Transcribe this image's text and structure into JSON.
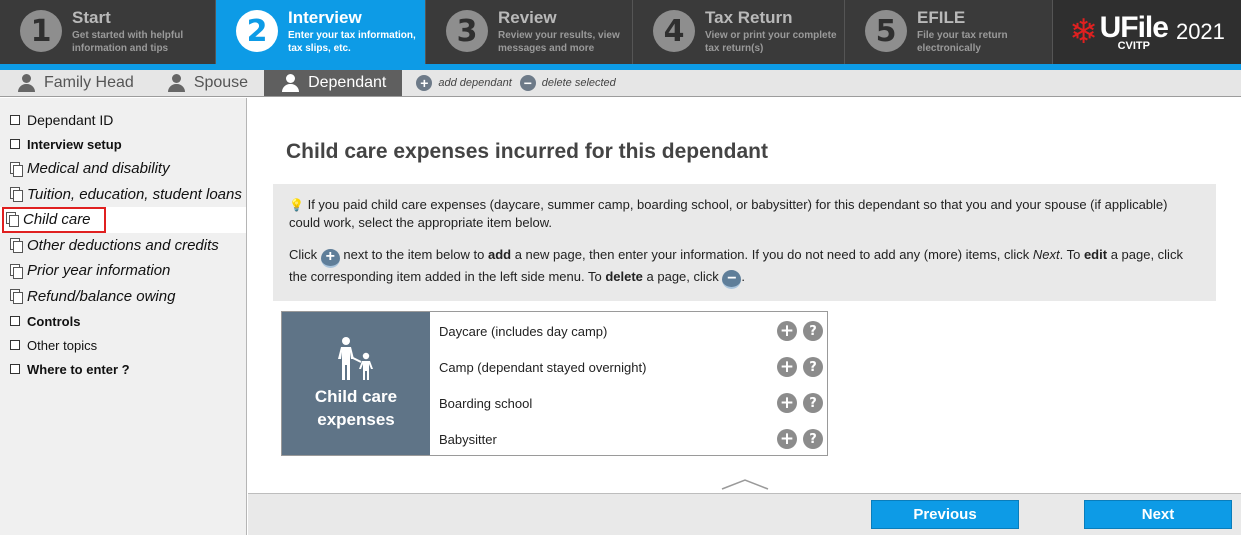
{
  "steps": [
    {
      "num": "1",
      "title": "Start",
      "desc1": "Get started with helpful",
      "desc2": "information and tips"
    },
    {
      "num": "2",
      "title": "Interview",
      "desc1": "Enter your tax information,",
      "desc2": "tax slips, etc."
    },
    {
      "num": "3",
      "title": "Review",
      "desc1": "Review your results, view",
      "desc2": "messages and more"
    },
    {
      "num": "4",
      "title": "Tax Return",
      "desc1": "View or print your complete",
      "desc2": "tax return(s)"
    },
    {
      "num": "5",
      "title": "EFILE",
      "desc1": "File your tax return",
      "desc2": "electronically"
    }
  ],
  "brand": {
    "name": "UFile",
    "sub": "CVITP",
    "year": "2021"
  },
  "tabs": [
    {
      "label": "Family Head"
    },
    {
      "label": "Spouse"
    },
    {
      "label": "Dependant"
    }
  ],
  "tab_actions": {
    "add": "add dependant",
    "delete": "delete selected"
  },
  "sidebar": {
    "items": [
      {
        "label": "Dependant ID"
      },
      {
        "label": "Interview setup"
      },
      {
        "label": "Medical and disability"
      },
      {
        "label": "Tuition, education, student loans"
      },
      {
        "label": "Child care"
      },
      {
        "label": "Other deductions and credits"
      },
      {
        "label": "Prior year information"
      },
      {
        "label": "Refund/balance owing"
      },
      {
        "label": "Controls"
      },
      {
        "label": "Other topics"
      },
      {
        "label": "Where to enter ?"
      }
    ]
  },
  "main": {
    "heading": "Child care expenses incurred for this dependant",
    "info1": "If you paid child care expenses (daycare, summer camp, boarding school, or babysitter) for this dependant so that you and your spouse (if applicable) could work, select the appropriate item below.",
    "info2_a": "Click",
    "info2_b": "next to the item below to",
    "info2_add": "add",
    "info2_c": "a new page, then enter your information. If you do not need to add any (more) items, click",
    "info2_next": "Next",
    "info2_d": ". To",
    "info2_edit": "edit",
    "info2_e": "a page, click the corresponding item added in the left side menu. To",
    "info2_delete": "delete",
    "info2_f": "a page, click",
    "info2_g": ".",
    "card_title_1": "Child care",
    "card_title_2": "expenses",
    "rows": [
      {
        "label": "Daycare (includes day camp)"
      },
      {
        "label": "Camp (dependant stayed overnight)"
      },
      {
        "label": "Boarding school"
      },
      {
        "label": "Babysitter"
      }
    ]
  },
  "footer": {
    "previous": "Previous",
    "next": "Next"
  },
  "colors": {
    "accent": "#0d9be6",
    "card": "#5f7487",
    "highlight": "#e02020"
  }
}
